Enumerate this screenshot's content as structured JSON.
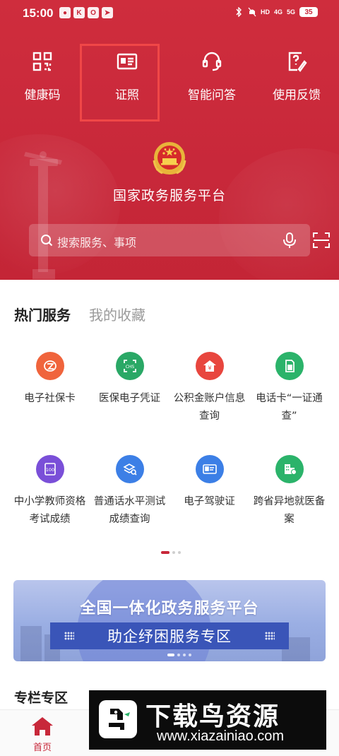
{
  "status_bar": {
    "time": "15:00",
    "app_icons": [
      "K",
      "O"
    ],
    "indicators": [
      "HD",
      "4G",
      "5G"
    ],
    "battery": "35"
  },
  "quick_actions": [
    {
      "label": "健康码",
      "icon": "qr-code-icon"
    },
    {
      "label": "证照",
      "icon": "id-card-icon"
    },
    {
      "label": "智能问答",
      "icon": "headset-icon"
    },
    {
      "label": "使用反馈",
      "icon": "feedback-icon"
    }
  ],
  "platform_title": "国家政务服务平台",
  "search": {
    "placeholder": "搜索服务、事项"
  },
  "tabs": {
    "active": "热门服务",
    "inactive": "我的收藏"
  },
  "services": [
    {
      "label": "电子社保卡",
      "icon": "social-security-icon",
      "color": "#f0643c"
    },
    {
      "label": "医保电子凭证",
      "icon": "medical-insurance-icon",
      "color": "#2aa866"
    },
    {
      "label": "公积金账户信息查询",
      "icon": "housing-fund-icon",
      "color": "#e8463e"
    },
    {
      "label": "电话卡“一证通查”",
      "icon": "sim-card-icon",
      "color": "#2bb36a"
    },
    {
      "label": "中小学教师资格考试成绩",
      "icon": "teacher-exam-icon",
      "color": "#7a4fd8"
    },
    {
      "label": "普通话水平测试成绩查询",
      "icon": "mandarin-test-icon",
      "color": "#3c7fe6"
    },
    {
      "label": "电子驾驶证",
      "icon": "driver-license-icon",
      "color": "#3c7fe6"
    },
    {
      "label": "跨省异地就医备案",
      "icon": "cross-province-medical-icon",
      "color": "#2bb36a"
    }
  ],
  "banner": {
    "title": "全国一体化政务服务平台",
    "subtitle": "助企纾困服务专区"
  },
  "section_title": "专栏专区",
  "bottom_nav": {
    "home_label": "首页"
  },
  "watermark": {
    "title": "下载鸟资源",
    "url": "www.xiazainiao.com"
  },
  "colors": {
    "primary_red": "#c8283a",
    "highlight_box": "#f04747",
    "banner_blue": "#3a55b8"
  }
}
